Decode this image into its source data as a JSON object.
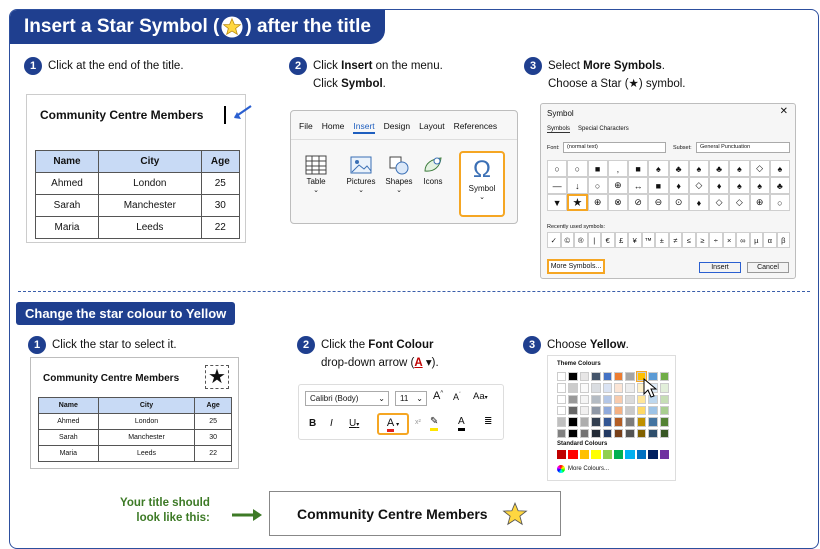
{
  "title": {
    "before": "Insert a Star Symbol (",
    "after": ") after the title"
  },
  "step1": {
    "num": "1",
    "text": "Click at the end of the title."
  },
  "step2": {
    "num": "2",
    "line1_a": "Click ",
    "line1_b": "Insert",
    "line1_c": " on the menu.",
    "line2_a": "Click ",
    "line2_b": "Symbol",
    "line2_c": "."
  },
  "step3": {
    "num": "3",
    "line1_a": "Select ",
    "line1_b": "More Symbols",
    "line1_c": ".",
    "line2": "Choose a Star (★) symbol."
  },
  "table1": {
    "heading": "Community Centre Members",
    "headers": [
      "Name",
      "City",
      "Age"
    ],
    "rows": [
      [
        "Ahmed",
        "London",
        "25"
      ],
      [
        "Sarah",
        "Manchester",
        "30"
      ],
      [
        "Maria",
        "Leeds",
        "22"
      ]
    ]
  },
  "ribbon": {
    "tabs": [
      "File",
      "Home",
      "Insert",
      "Design",
      "Layout",
      "References"
    ],
    "active_tab": "Insert",
    "buttons": [
      "Table",
      "Pictures",
      "Shapes",
      "Icons",
      "Symbol"
    ]
  },
  "symbol_dialog": {
    "title": "Symbol",
    "tabs": [
      "Symbols",
      "Special Characters"
    ],
    "font_label": "Font:",
    "font_value": "(normal text)",
    "subset_label": "Subset:",
    "subset_value": "General Punctuation",
    "grid": [
      [
        "○",
        "○",
        "■",
        "‚",
        "■",
        "♠",
        "♣",
        "♠",
        "♣",
        "♠",
        "◇",
        "♠"
      ],
      [
        "—",
        "↓",
        "○",
        "⊕",
        "↔",
        "■",
        "♦",
        "◇",
        "♦",
        "♠",
        "♠",
        "♣"
      ],
      [
        "▼",
        "★",
        "⊕",
        "⊗",
        "⊘",
        "⊖",
        "⊙",
        "♦",
        "◇",
        "◇",
        "⊕",
        "○"
      ]
    ],
    "recent_label": "Recently used symbols:",
    "recent": [
      "✓",
      "©",
      "®",
      "|",
      "€",
      "£",
      "¥",
      "™",
      "±",
      "≠",
      "≤",
      "≥",
      "÷",
      "×",
      "∞",
      "µ",
      "α",
      "β"
    ],
    "more_symbols": "More Symbols...",
    "insert": "Insert",
    "cancel": "Cancel"
  },
  "section2_title": "Change the star colour to Yellow",
  "step4": {
    "num": "1",
    "text": "Click the star to select it."
  },
  "step5": {
    "num": "2",
    "line1_a": "Click the ",
    "line1_b": "Font Colour",
    "line2_a": "drop-down arrow (",
    "line2_b": "A",
    "line2_c": " ▾)."
  },
  "step6": {
    "num": "3",
    "line1_a": "Choose ",
    "line1_b": "Yellow",
    "line1_c": "."
  },
  "table2": {
    "heading": "Community Centre Members",
    "headers": [
      "Name",
      "City",
      "Age"
    ],
    "rows": [
      [
        "Ahmed",
        "London",
        "25"
      ],
      [
        "Sarah",
        "Manchester",
        "30"
      ],
      [
        "Maria",
        "Leeds",
        "22"
      ]
    ]
  },
  "font_toolbar": {
    "font": "Calibri (Body)",
    "size": "11",
    "grow": "A",
    "shrink": "A",
    "case": "Aa",
    "bold": "B",
    "italic": "I",
    "underline": "U",
    "font_colour": "A",
    "highlight": "✎",
    "text_colour": "A"
  },
  "palette": {
    "theme_label": "Theme Colours",
    "standard_label": "Standard Colours",
    "more_colours": "More Colours...",
    "theme_top": [
      "#ffffff",
      "#000000",
      "#e7e6e6",
      "#44546a",
      "#4472c4",
      "#ed7d31",
      "#a5a5a5",
      "#ffc000",
      "#5b9bd5",
      "#70ad47"
    ],
    "standard": [
      "#c00000",
      "#ff0000",
      "#ffc000",
      "#ffff00",
      "#92d050",
      "#00b050",
      "#00b0f0",
      "#0070c0",
      "#002060",
      "#7030a0"
    ],
    "accent_yellow": "#ffc000"
  },
  "result": {
    "label_line1": "Your title should",
    "label_line2": "look like this:",
    "text": "Community Centre Members",
    "star_colour": "#ffd740"
  },
  "colors": {
    "brand": "#1f3f8f",
    "accent_green": "#3d7a26",
    "star_yellow": "#ffd740",
    "highlight_orange": "#f5a623"
  }
}
